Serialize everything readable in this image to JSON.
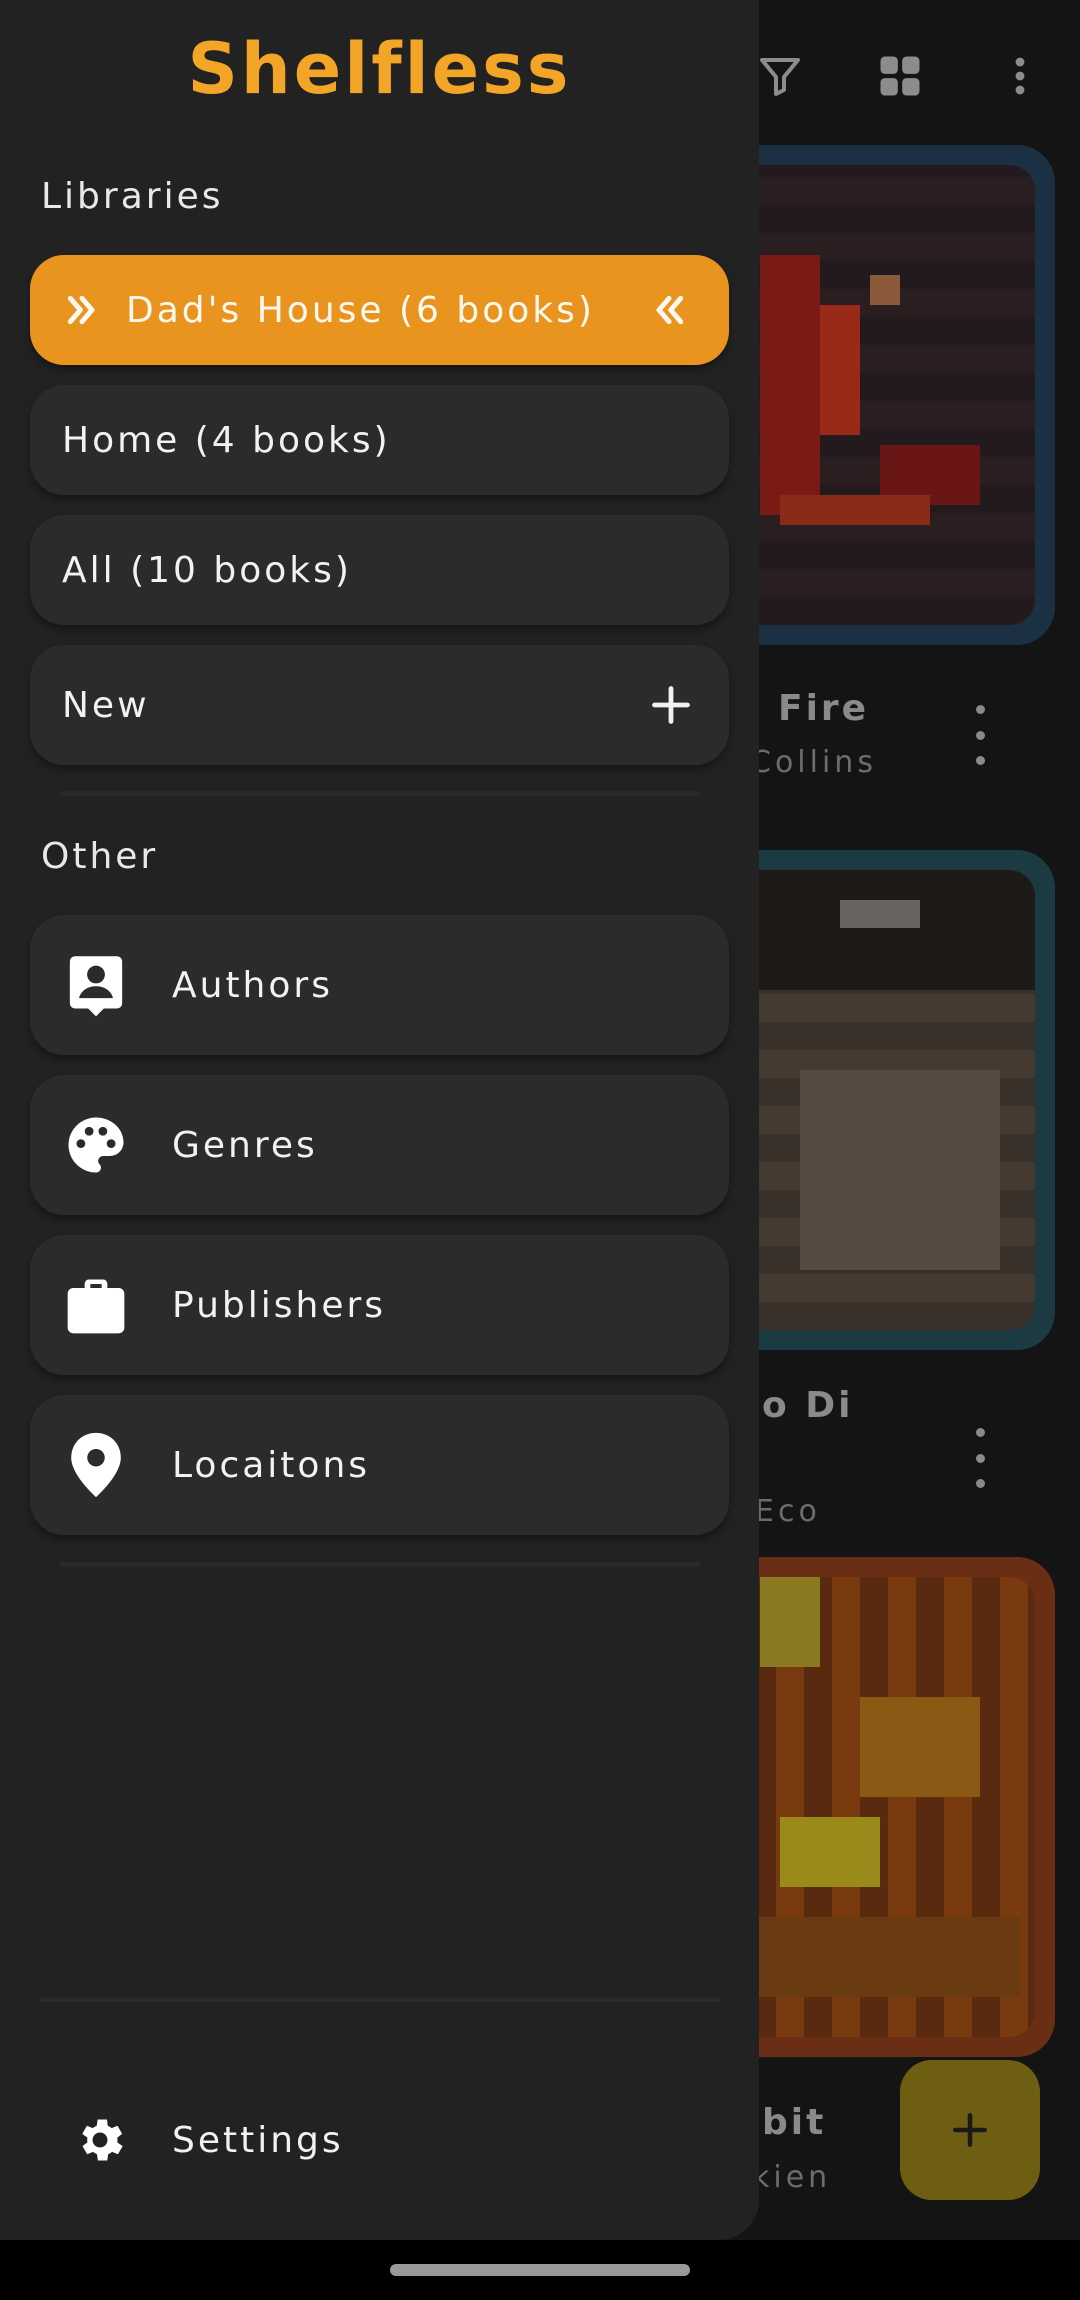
{
  "app": {
    "title": "Shelfless"
  },
  "libraries": {
    "heading": "Libraries",
    "items": [
      {
        "label": "Dad's House (6 books)",
        "active": true
      },
      {
        "label": "Home (4 books)"
      },
      {
        "label": "All (10 books)"
      },
      {
        "label": "New"
      }
    ]
  },
  "other": {
    "heading": "Other",
    "items": [
      {
        "label": "Authors",
        "icon": "person-badge-icon"
      },
      {
        "label": "Genres",
        "icon": "palette-icon"
      },
      {
        "label": "Publishers",
        "icon": "briefcase-icon"
      },
      {
        "label": "Locaitons",
        "icon": "location-pin-icon"
      }
    ]
  },
  "settings": {
    "label": "Settings",
    "icon": "gear-icon"
  },
  "background": {
    "toolbar_icons": [
      "filter-icon",
      "grid-view-icon",
      "more-vert-icon"
    ],
    "books": [
      {
        "title": "Fire",
        "author": "Collins"
      },
      {
        "title": "o Di",
        "author": "Eco"
      },
      {
        "title": "bit",
        "author": "kien"
      }
    ]
  },
  "colors": {
    "accent": "#f2a526",
    "active_item": "#e8941f",
    "drawer": "#222222",
    "item": "#2b2b2b",
    "fab": "#6e5e12"
  }
}
